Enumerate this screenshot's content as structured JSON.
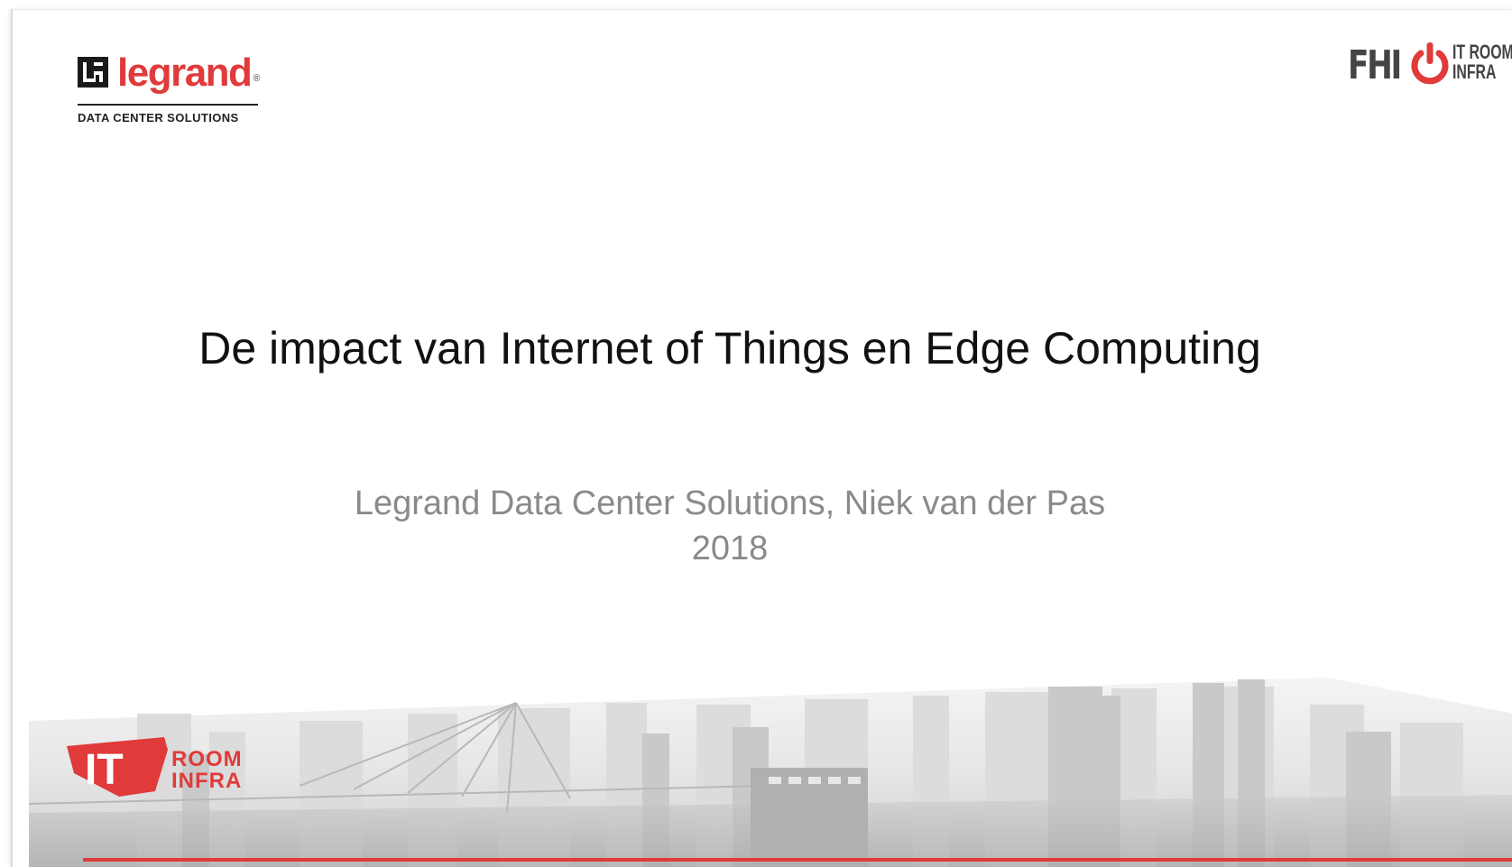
{
  "logos": {
    "legrand": {
      "word": "legrand",
      "registered": "®",
      "tagline": "DATA CENTER SOLUTIONS"
    },
    "fhi": {
      "word": "FHI",
      "line1": "IT ROOM",
      "line2": "INFRA"
    },
    "it_room_infra": {
      "big": "IT",
      "line1": "ROOM",
      "line2": "INFRA"
    }
  },
  "slide": {
    "title": "De impact van Internet of Things en Edge Computing",
    "subtitle_line1": "Legrand Data Center Solutions, Niek van der Pas",
    "subtitle_line2": "2018"
  },
  "colors": {
    "brand_red": "#e03a3a",
    "dark_text": "#111111",
    "subtitle_gray": "#8a8a8a",
    "logo_gray": "#444444"
  }
}
